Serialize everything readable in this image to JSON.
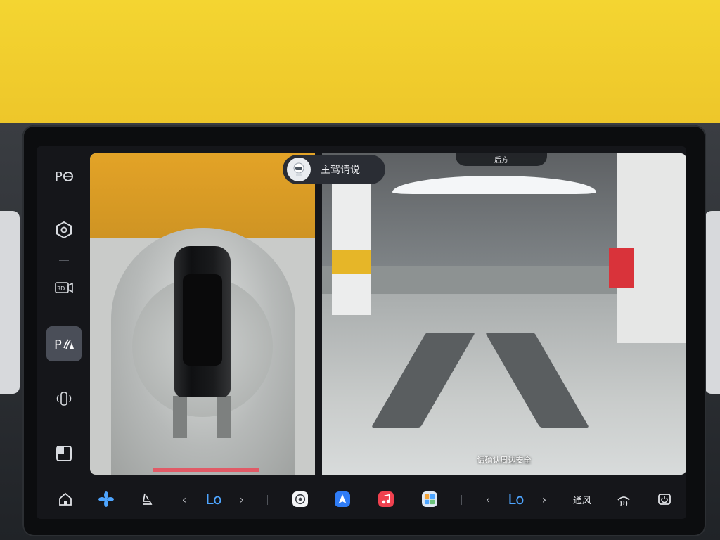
{
  "voice_assistant": {
    "label": "主驾请说"
  },
  "rear_view": {
    "label": "后方",
    "caution": "请确认周边安全"
  },
  "nav": {
    "items": [
      {
        "id": "parking-assist",
        "label": "P"
      },
      {
        "id": "settings"
      },
      {
        "id": "3d-view",
        "label": "3D"
      },
      {
        "id": "parking-radar",
        "label": "P",
        "active": true
      },
      {
        "id": "car-view"
      },
      {
        "id": "split-view"
      }
    ]
  },
  "dock": {
    "left_temp": "Lo",
    "right_temp": "Lo",
    "chev_left": "‹",
    "chev_right": "›",
    "vent_label": "通风"
  },
  "colors": {
    "accent": "#4ea5ff",
    "nav_active": "#4a4e58",
    "screen_bg": "#15161a"
  }
}
